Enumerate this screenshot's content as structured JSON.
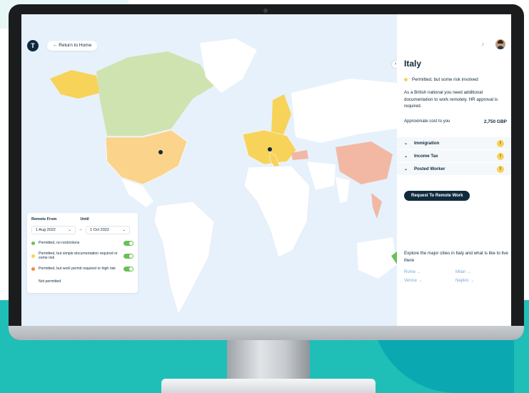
{
  "map": {
    "return_label": "← Return to Home",
    "logo_glyph": "T",
    "markers": 2
  },
  "filter": {
    "from_label": "Remote From",
    "until_label": "Until",
    "from_value": "1 Aug 2022",
    "until_value": "1 Oct 2022",
    "separator": "–",
    "legend": [
      {
        "text": "Permitted, no restrictions",
        "color": "#6bbf5a",
        "toggle": true
      },
      {
        "text": "Permitted, but simple documentation required or some risk",
        "color": "#f7d35a",
        "toggle": true
      },
      {
        "text": "Permitted, but work permit required or high risk",
        "color": "#f08a3c",
        "toggle": true
      },
      {
        "text": "Not permitted",
        "color": "#ffffff",
        "toggle": false
      }
    ]
  },
  "panel": {
    "country": "Italy",
    "status": "Permitted, but some risk involved",
    "description": "As a British national you need additional documentation to work remotely. HR approval is required.",
    "cost_label": "Approximate cost to you",
    "cost_value": "2,750 GBP",
    "accordion": [
      {
        "label": "Immigration"
      },
      {
        "label": "Income Tax"
      },
      {
        "label": "Posted Worker"
      }
    ],
    "request_label": "Request To Remote Work",
    "explore_text": "Explore the major cities in Italy and what is like to live there",
    "cities": [
      "Rome →",
      "Milan →",
      "Venice →",
      "Naples →"
    ],
    "collapse_glyph": "›",
    "bell_glyph": "♫"
  },
  "colors": {
    "navy": "#0f2a3d",
    "green": "#6bbf5a",
    "yellow": "#f7d35a",
    "salmon": "#f2b8a3",
    "ocean": "#e6f1fb",
    "teal_bg": "#1fbfb8"
  }
}
